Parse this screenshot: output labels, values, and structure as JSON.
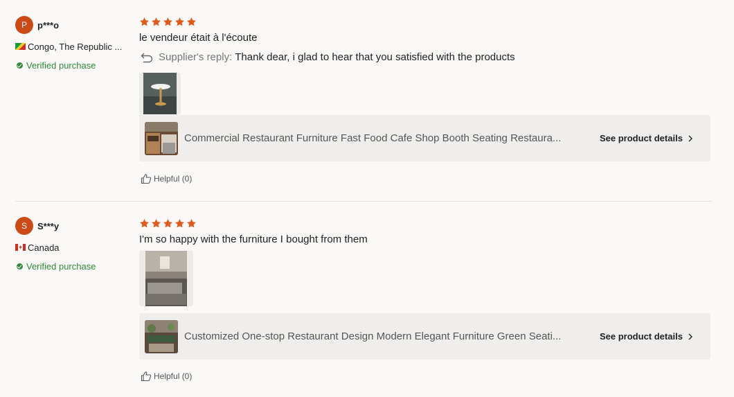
{
  "reviews": [
    {
      "avatar_letter": "P",
      "name": "p***o",
      "country": "Congo, The Republic ...",
      "verified_label": "Verified purchase",
      "rating": 5,
      "text": "le vendeur était à l'écoute",
      "reply_label": "Supplier's reply:",
      "reply_text": "Thank dear, i glad to hear that you satisfied with the products",
      "product_title": "Commercial Restaurant Furniture Fast Food Cafe Shop Booth Seating Restaura...",
      "see_details_label": "See product details",
      "helpful_label": "Helpful (0)"
    },
    {
      "avatar_letter": "S",
      "name": "S***y",
      "country": "Canada",
      "verified_label": "Verified purchase",
      "rating": 5,
      "text": "I'm so happy with the furniture I bought from them",
      "product_title": "Customized One-stop Restaurant Design Modern Elegant Furniture Green Seati...",
      "see_details_label": "See product details",
      "helpful_label": "Helpful (0)"
    }
  ],
  "colors": {
    "accent": "#cc4a15",
    "star": "#e05b1a",
    "verified": "#2f8a3a",
    "card_bg": "#efeeec"
  },
  "icons": [
    "star-icon",
    "reply-arrow-icon",
    "chevron-right-icon",
    "thumbs-up-icon",
    "verified-check-icon"
  ]
}
